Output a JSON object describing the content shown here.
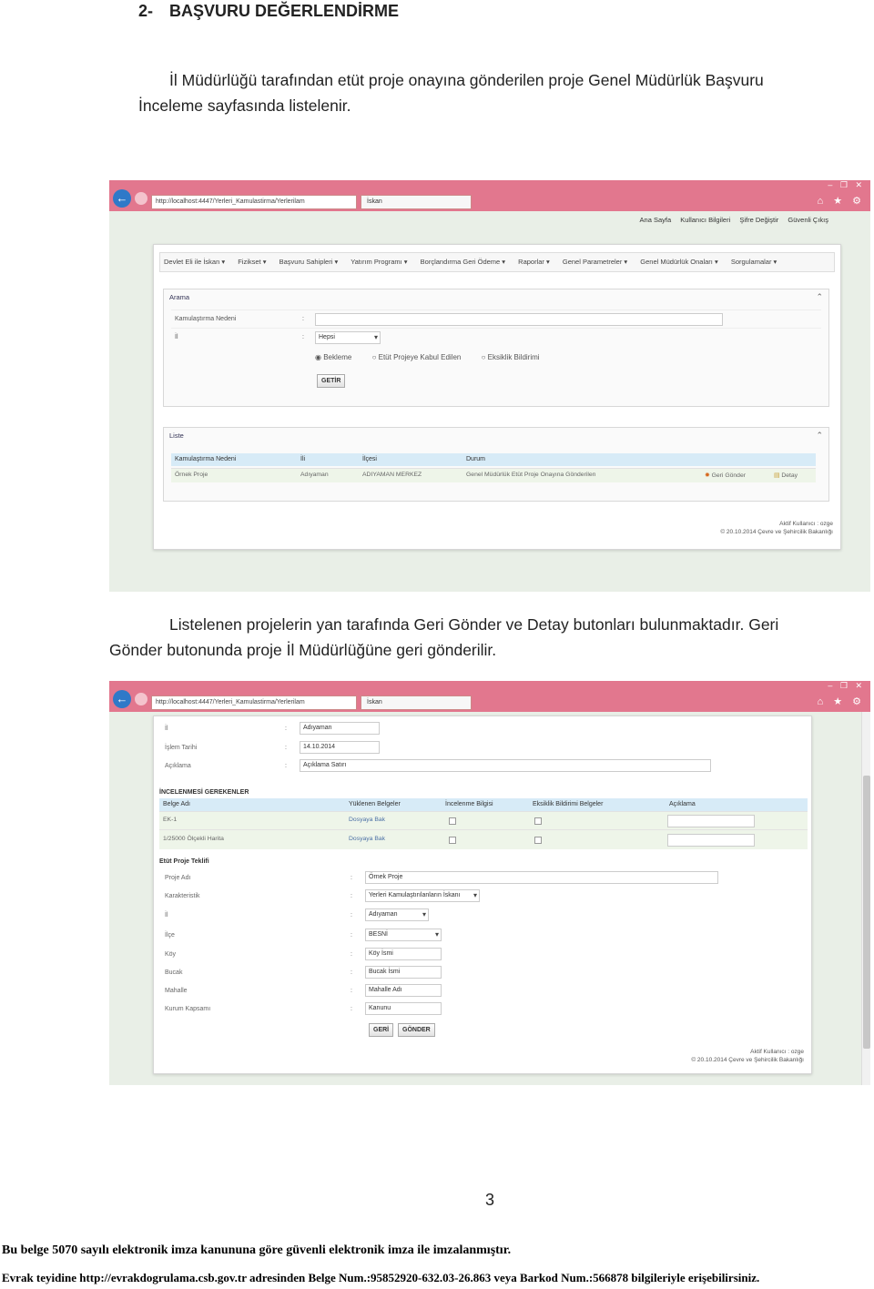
{
  "section": {
    "number": "2-",
    "title": "BAŞVURU DEĞERLENDİRME"
  },
  "para1": {
    "line1": "İl Müdürlüğü tarafından etüt proje onayına gönderilen proje Genel Müdürlük Başvuru",
    "line2": "İnceleme sayfasında listelenir."
  },
  "para2": {
    "line1": "Listelenen projelerin yan tarafında Geri Gönder ve Detay butonları bulunmaktadır. Geri",
    "line2": "Gönder butonunda proje İl Müdürlüğüne geri gönderilir."
  },
  "browser": {
    "address": "http://localhost:4447/Yerleri_Kamulastirma/Yerlerilam",
    "tab": "İskan",
    "window_controls": "– ❐ ✕",
    "right_icons": "⌂ ★ ⚙"
  },
  "shot1": {
    "top_links": [
      "Ana Sayfa",
      "Kullanıcı Bilgileri",
      "Şifre Değiştir",
      "Güvenli Çıkış"
    ],
    "menu": [
      "Devlet Eli ile İskan ▾",
      "Fizikset ▾",
      "Başvuru Sahipleri ▾",
      "Yatırım Programı ▾",
      "Borçlandırma Geri Ödeme ▾",
      "Raporlar ▾",
      "Genel Parametreler ▾",
      "Genel Müdürlük Onaları ▾",
      "Sorgulamalar ▾"
    ],
    "search": {
      "title": "Arama",
      "fields": [
        {
          "label": "Kamulaştırma Nedeni",
          "value": ""
        },
        {
          "label": "İl",
          "value": "Hepsi"
        }
      ],
      "radios": [
        "Bekleme",
        "Etüt Projeye Kabul Edilen",
        "Eksiklik Bildirimi"
      ],
      "button": "GETİR"
    },
    "list": {
      "title": "Liste",
      "columns": [
        "Kamulaştırma Nedeni",
        "İli",
        "İlçesi",
        "Durum"
      ],
      "rows": [
        {
          "cells": [
            "Örnek Proje",
            "Adıyaman",
            "ADIYAMAN MERKEZ",
            "Genel Müdürlük Etüt Proje Onayına Gönderilen"
          ],
          "actions": [
            "Geri Gönder",
            "Detay"
          ]
        }
      ]
    },
    "footer": {
      "user": "Aktif Kullanıcı : ozge",
      "copyright": "© 20.10.2014 Çevre ve Şehircilik Bakanlığı"
    }
  },
  "shot2": {
    "info": [
      {
        "label": "İl",
        "value": "Adıyaman"
      },
      {
        "label": "İşlem Tarihi",
        "value": "14.10.2014"
      },
      {
        "label": "Açıklama",
        "value": "Açıklama Satırı"
      }
    ],
    "docs_section": "İNCELENMESİ GEREKENLER",
    "doc_columns": [
      "Belge Adı",
      "Yüklenen Belgeler",
      "İncelenme Bilgisi",
      "Eksiklik Bildirimi Belgeler",
      "Açıklama"
    ],
    "doc_rows": [
      {
        "name": "EK-1",
        "file": "Dosyaya Bak"
      },
      {
        "name": "1/25000 Ölçekli Harita",
        "file": "Dosyaya Bak"
      }
    ],
    "proposal_section": "Etüt Proje Teklifi",
    "proposal": [
      {
        "label": "Proje Adı",
        "value": "Örnek Proje"
      },
      {
        "label": "Karakteristik",
        "value": "Yerleri Kamulaştırılanların İskanı"
      },
      {
        "label": "İl",
        "value": "Adıyaman"
      },
      {
        "label": "İlçe",
        "value": "BESNİ"
      },
      {
        "label": "Köy",
        "value": "Köy İsmi"
      },
      {
        "label": "Bucak",
        "value": "Bucak İsmi"
      },
      {
        "label": "Mahalle",
        "value": "Mahalle Adı"
      },
      {
        "label": "Kurum Kapsamı",
        "value": "Kanunu"
      }
    ],
    "buttons": [
      "GERİ",
      "GÖNDER"
    ],
    "footer": {
      "user": "Aktif Kullanıcı : ozge",
      "copyright": "© 20.10.2014 Çevre ve Şehircilik Bakanlığı"
    }
  },
  "page_number": "3",
  "legal": {
    "line1": "Bu belge 5070 sayılı elektronik imza kanununa göre güvenli elektronik imza ile imzalanmıştır.",
    "line2": "Evrak teyidine http://evrakdogrulama.csb.gov.tr adresinden Belge Num.:95852920-632.03-26.863 veya Barkod Num.:566878 bilgileriyle erişebilirsiniz."
  }
}
